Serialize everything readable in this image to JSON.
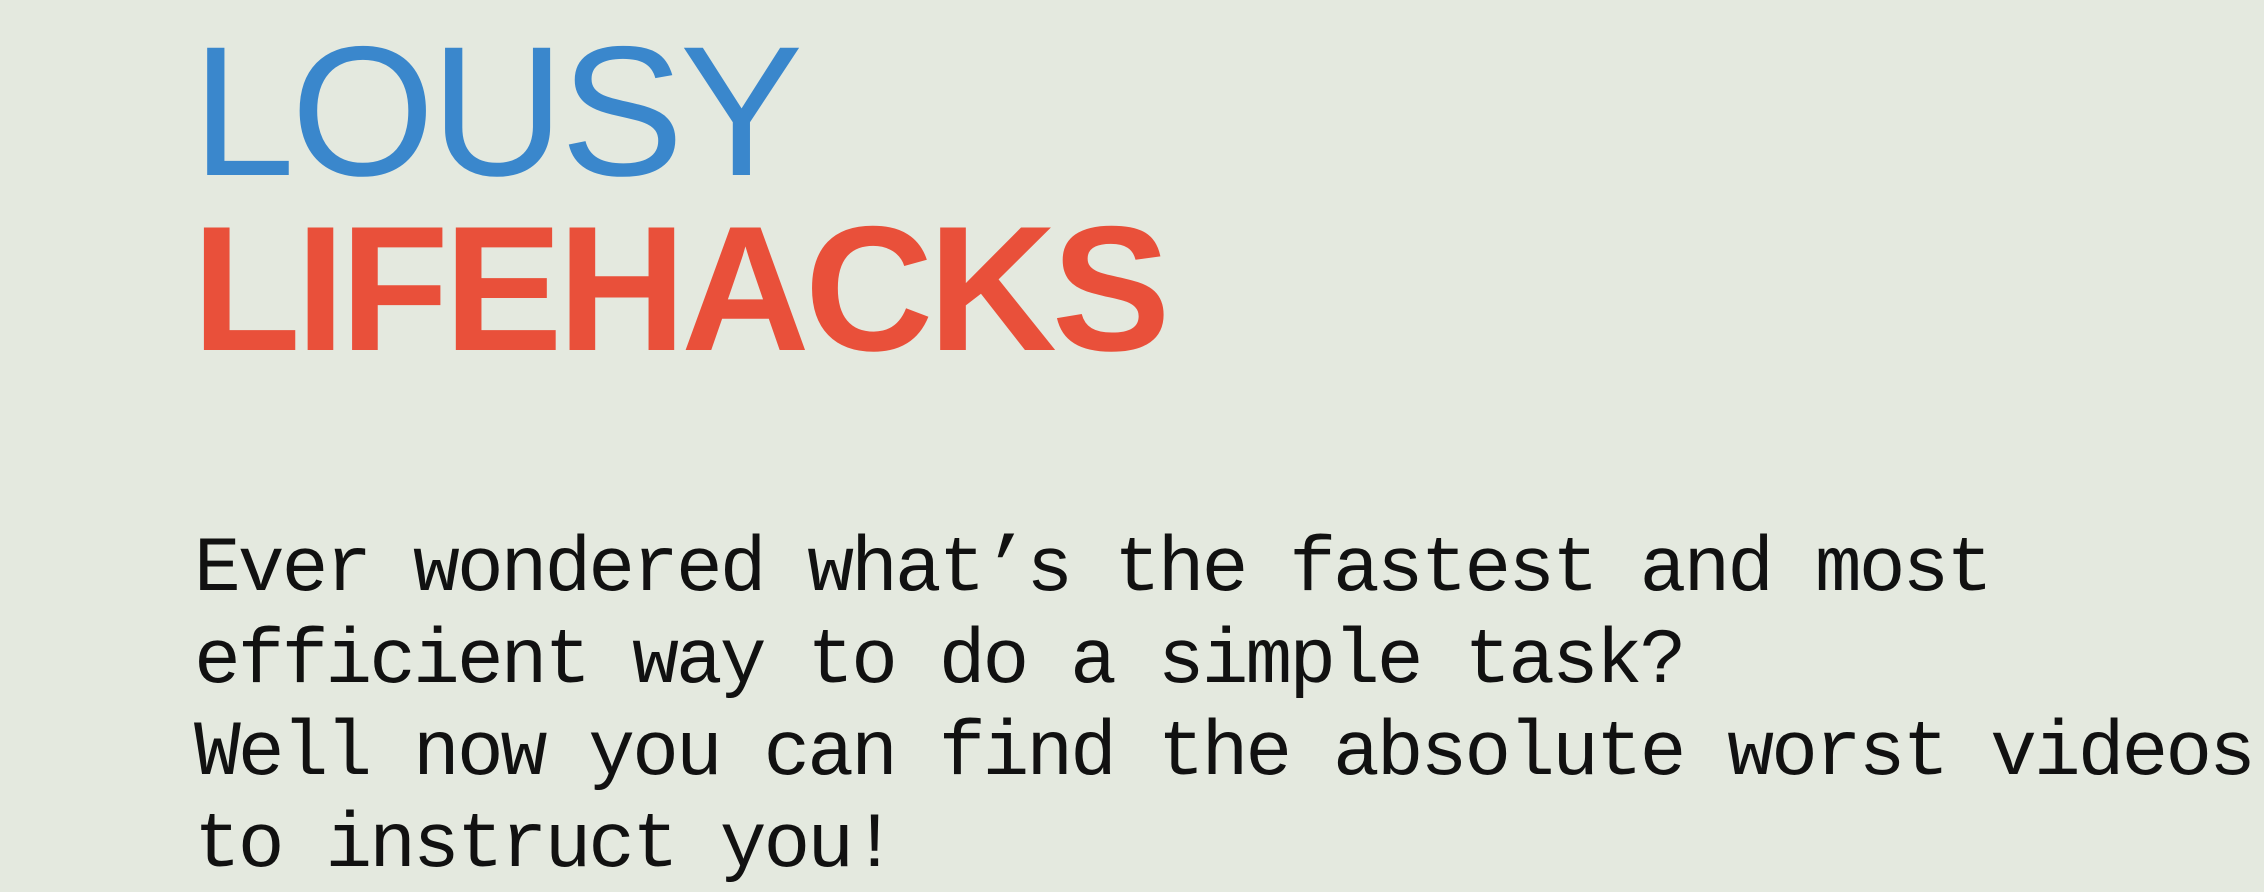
{
  "header": {
    "title_line1": "LOUSY",
    "title_line2": "LIFEHACKS"
  },
  "intro": {
    "lines": [
      "Ever wondered what’s the fastest and most",
      "efficient way to do a simple task?",
      "Well now you can find the absolute worst videos",
      "to instruct you!"
    ]
  },
  "colors": {
    "background": "#e4e9df",
    "title_blue": "#3a87cc",
    "title_red": "#e9503a",
    "body_text": "#111111"
  }
}
